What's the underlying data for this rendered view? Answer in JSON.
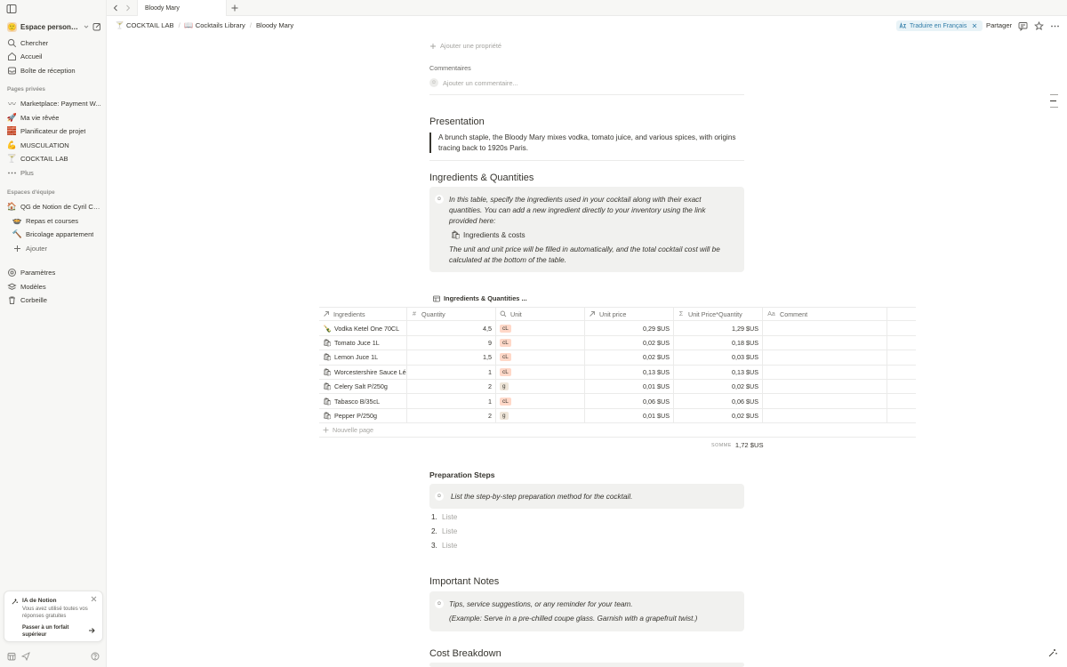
{
  "tab": {
    "title": "Bloody Mary"
  },
  "workspace": {
    "name": "Espace personnel...",
    "emoji": "🙂"
  },
  "sidebar": {
    "top_items": [
      {
        "label": "Chercher"
      },
      {
        "label": "Accueil"
      },
      {
        "label": "Boîte de réception"
      }
    ],
    "private_label": "Pages privées",
    "private_items": [
      {
        "label": "Marketplace: Payment W...",
        "emoji": "〰"
      },
      {
        "label": "Ma vie rêvée",
        "emoji": "🚀"
      },
      {
        "label": "Planificateur de projet",
        "emoji": "🧱"
      },
      {
        "label": "MUSCULATION",
        "emoji": "💪"
      },
      {
        "label": "COCKTAIL LAB",
        "emoji": "🍸"
      },
      {
        "label": "Plus"
      }
    ],
    "team_label": "Espaces d'équipe",
    "team_items": [
      {
        "label": "QG de Notion de Cyril CA...",
        "emoji": "🏠"
      },
      {
        "label": "Repas et courses",
        "emoji": "🍲"
      },
      {
        "label": "Bricolage appartement",
        "emoji": "🔨"
      },
      {
        "label": "Ajouter"
      }
    ],
    "bottom_items": [
      {
        "label": "Paramètres"
      },
      {
        "label": "Modèles"
      },
      {
        "label": "Corbeille"
      }
    ],
    "ai_card": {
      "title": "IA de Notion",
      "text": "Vous avez utilisé toutes vos réponses gratuites",
      "cta": "Passer à un forfait supérieur"
    }
  },
  "breadcrumbs": [
    {
      "label": "COCKTAIL LAB",
      "emoji": "🍸"
    },
    {
      "label": "Cocktails Library",
      "emoji": "📖"
    },
    {
      "label": "Bloody Mary"
    }
  ],
  "topbar": {
    "translate": "Traduire en Français",
    "share": "Partager"
  },
  "page": {
    "add_property": "Ajouter une propriété",
    "comments_label": "Commentaires",
    "comment_placeholder": "Ajouter un commentaire...",
    "presentation": {
      "heading": "Presentation",
      "text": "A brunch staple, the Bloody Mary mixes vodka, tomato juice, and various spices, with origins tracing back to 1920s Paris."
    },
    "ingredients": {
      "heading": "Ingredients & Quantities",
      "callout_text": "In this table, specify the ingredients used in your cocktail along with their exact quantities. You can add a new ingredient directly to your inventory using the link provided here:",
      "link": "Ingredients & costs",
      "callout_text2": "The unit and unit price will be filled in automatically, and the total cocktail cost will be calculated at the bottom of the table."
    },
    "table": {
      "title": "Ingredients & Quantities ...",
      "columns": [
        "Ingredients",
        "Quantity",
        "Unit",
        "Unit price",
        "Unit Price*Quantity",
        "Comment"
      ],
      "rows": [
        {
          "name": "Vodka Ketel One 70CL",
          "qty": "4,5",
          "unit": "cL",
          "price": "0,29 $US",
          "total": "1,29 $US"
        },
        {
          "name": "Tomato Juce 1L",
          "qty": "9",
          "unit": "cL",
          "price": "0,02 $US",
          "total": "0,18 $US"
        },
        {
          "name": "Lemon Juce 1L",
          "qty": "1,5",
          "unit": "cL",
          "price": "0,02 $US",
          "total": "0,03 $US"
        },
        {
          "name": "Worcestershire Sauce Léa",
          "qty": "1",
          "unit": "cL",
          "price": "0,13 $US",
          "total": "0,13 $US"
        },
        {
          "name": "Celery Salt P/250g",
          "qty": "2",
          "unit": "g",
          "price": "0,01 $US",
          "total": "0,02 $US"
        },
        {
          "name": "Tabasco B/35cL",
          "qty": "1",
          "unit": "cL",
          "price": "0,06 $US",
          "total": "0,06 $US"
        },
        {
          "name": "Pepper P/250g",
          "qty": "2",
          "unit": "g",
          "price": "0,01 $US",
          "total": "0,02 $US"
        }
      ],
      "new_page": "Nouvelle page",
      "sum_label": "SOMME",
      "sum_value": "1,72 $US"
    },
    "prep": {
      "heading": "Preparation Steps",
      "callout": "List the step-by-step preparation method for the cocktail.",
      "items": [
        {
          "n": "1.",
          "placeholder": "Liste"
        },
        {
          "n": "2.",
          "placeholder": "Liste"
        },
        {
          "n": "3.",
          "placeholder": "Liste"
        }
      ]
    },
    "notes": {
      "heading": "Important Notes",
      "line1": "Tips, service suggestions, or any reminder for your team.",
      "line2": "(Example: Serve in a pre-chilled coupe glass. Garnish with a grapefruit twist.)"
    },
    "cost": {
      "heading": "Cost Breakdown"
    }
  }
}
